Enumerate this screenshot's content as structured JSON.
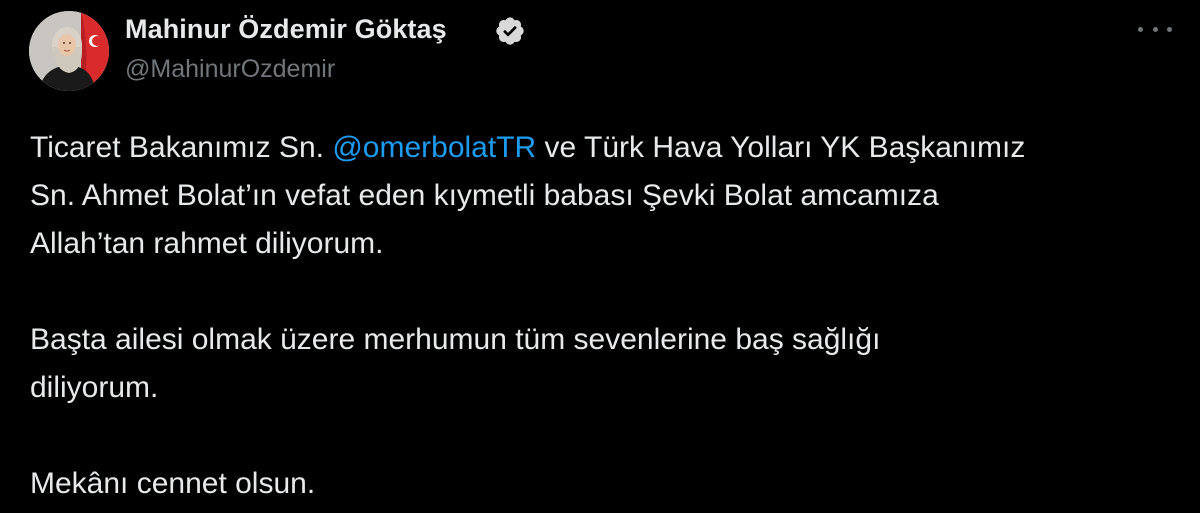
{
  "author": {
    "name": "Mahinur Özdemir Göktaş",
    "handle": "@MahinurOzdemir"
  },
  "tweet": {
    "p1": {
      "l1_before": "Ticaret Bakanımız Sn. ",
      "mention": "@omerbolatTR",
      "l1_after": " ve Türk Hava Yolları YK Başkanımız",
      "l2": "Sn. Ahmet Bolat’ın vefat eden kıymetli babası Şevki Bolat amcamıza",
      "l3": "Allah’tan rahmet diliyorum."
    },
    "p2": {
      "l1": "Başta ailesi olmak üzere merhumun tüm sevenlerine baş sağlığı",
      "l2": "diliyorum."
    },
    "p3": {
      "l1": "Mekânı cennet olsun."
    }
  },
  "icons": {
    "verified": "verified-badge-icon",
    "more": "more-options-icon"
  },
  "colors": {
    "background": "#000000",
    "text": "#e7e9ea",
    "secondary": "#71767b",
    "link": "#1d9bf0"
  }
}
